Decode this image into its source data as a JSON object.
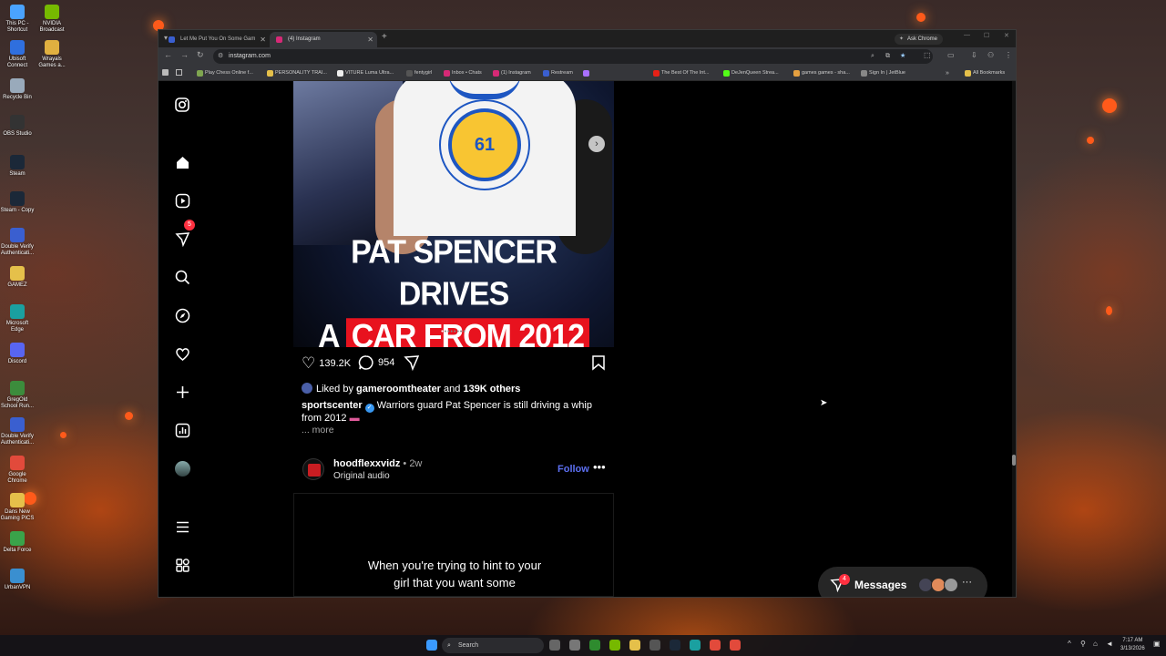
{
  "desktop": {
    "icons": [
      {
        "label": "This PC - Shortcut",
        "color": "#4aa3ff"
      },
      {
        "label": "NVIDIA Broadcast",
        "color": "#76b900"
      },
      {
        "label": "Ubisoft Connect",
        "color": "#2f6fde"
      },
      {
        "label": "Wrayals Games a...",
        "color": "#e0b040"
      },
      {
        "label": "Recycle Bin",
        "color": "#9ab"
      },
      {
        "label": "OBS Studio",
        "color": "#333"
      },
      {
        "label": "Steam",
        "color": "#1b2838"
      },
      {
        "label": "Steam - Copy",
        "color": "#1b2838"
      },
      {
        "label": "Double Verify Authenticati...",
        "color": "#3a5fd0"
      },
      {
        "label": "GAMEZ",
        "color": "#e5c04a"
      },
      {
        "label": "Microsoft Edge",
        "color": "#1aa0a0"
      },
      {
        "label": "Discord",
        "color": "#5865f2"
      },
      {
        "label": "GregOld School Run...",
        "color": "#3c8c3c"
      },
      {
        "label": "Double Verify Authenticati...",
        "color": "#3a5fd0"
      },
      {
        "label": "Google Chrome",
        "color": "#e24a3b"
      },
      {
        "label": "Dans New Gaming PICS",
        "color": "#e5c04a"
      },
      {
        "label": "Delta Force",
        "color": "#3aa34a"
      },
      {
        "label": "UrbanVPN",
        "color": "#3a8fd0"
      }
    ]
  },
  "browser": {
    "tabs": [
      {
        "title": "Let Me Put You On Some Gam",
        "color": "#3a5fd0"
      },
      {
        "title": "(4) Instagram",
        "color": "#d62976"
      }
    ],
    "ask_chrome": "Ask Chrome",
    "url": "instagram.com",
    "bookmarks": [
      {
        "label": "Play Chess Online f...",
        "color": "#7fa650"
      },
      {
        "label": "PERSONALITY TRAI...",
        "color": "#e5c04a"
      },
      {
        "label": "VITURE Luma Ultra...",
        "color": "#eee"
      },
      {
        "label": "fentygirl",
        "color": "#555"
      },
      {
        "label": "Inbox • Chats",
        "color": "#d62976"
      },
      {
        "label": "(1) Instagram",
        "color": "#d62976"
      },
      {
        "label": "Restream",
        "color": "#3a5fd0"
      },
      {
        "label": "",
        "color": "#a970ff"
      },
      {
        "label": "The Best Of The Int...",
        "color": "#e62117"
      },
      {
        "label": "DeJenQueen Strea...",
        "color": "#53fc18"
      },
      {
        "label": "games games - sha...",
        "color": "#e5a040"
      },
      {
        "label": "Sign In | JetBlue",
        "color": "#888"
      },
      {
        "label": "All Bookmarks",
        "color": "#e5c04a"
      }
    ]
  },
  "instagram": {
    "notifications_badge": "5",
    "post1": {
      "headline_line1": "PAT SPENCER DRIVES",
      "headline_a": "A",
      "headline_red": "CAR FROM 2012",
      "jersey_number": "61",
      "likes": "139.2K",
      "comments": "954",
      "liked_by_prefix": "Liked by",
      "liked_by_user": "gameroomtheater",
      "liked_by_and": "and",
      "liked_by_others": "139K others",
      "author": "sportscenter",
      "caption": "Warriors guard Pat Spencer is still driving a whip from 2012",
      "more": "... more"
    },
    "post2": {
      "author": "hoodflexxvidz",
      "age": "• 2w",
      "audio": "Original audio",
      "follow": "Follow",
      "overlay_text_1": "When you're trying to hint to your",
      "overlay_text_2": "girl that you want some"
    },
    "messages": {
      "label": "Messages",
      "badge": "4"
    }
  },
  "taskbar": {
    "search": "Search",
    "time": "7:17 AM",
    "date": "3/13/2026"
  }
}
